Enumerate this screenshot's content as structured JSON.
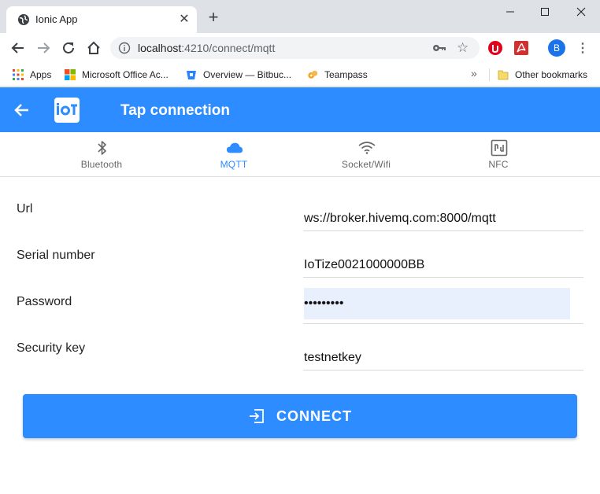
{
  "browser": {
    "tab_title": "Ionic App",
    "url_host": "localhost",
    "url_path": ":4210/connect/mqtt",
    "avatar_letter": "B",
    "bookmarks": [
      {
        "label": "Apps"
      },
      {
        "label": "Microsoft Office Ac..."
      },
      {
        "label": "Overview — Bitbuc..."
      },
      {
        "label": "Teampass"
      }
    ],
    "more_bookmarks": "»",
    "other_bookmarks": "Other bookmarks"
  },
  "app": {
    "title": "Tap connection",
    "accent_color": "#2d8cff"
  },
  "segments": [
    {
      "label": "Bluetooth",
      "icon": "bluetooth-icon",
      "active": false
    },
    {
      "label": "MQTT",
      "icon": "cloud-icon",
      "active": true
    },
    {
      "label": "Socket/Wifi",
      "icon": "wifi-icon",
      "active": false
    },
    {
      "label": "NFC",
      "icon": "nfc-icon",
      "active": false
    }
  ],
  "form": {
    "url_label": "Url",
    "url_value": "ws://broker.hivemq.com:8000/mqtt",
    "serial_label": "Serial number",
    "serial_value": "IoTize0021000000BB",
    "password_label": "Password",
    "password_value": "•••••••••",
    "security_label": "Security key",
    "security_value": "testnetkey"
  },
  "connect_button": {
    "label": "CONNECT",
    "icon": "login-icon"
  }
}
